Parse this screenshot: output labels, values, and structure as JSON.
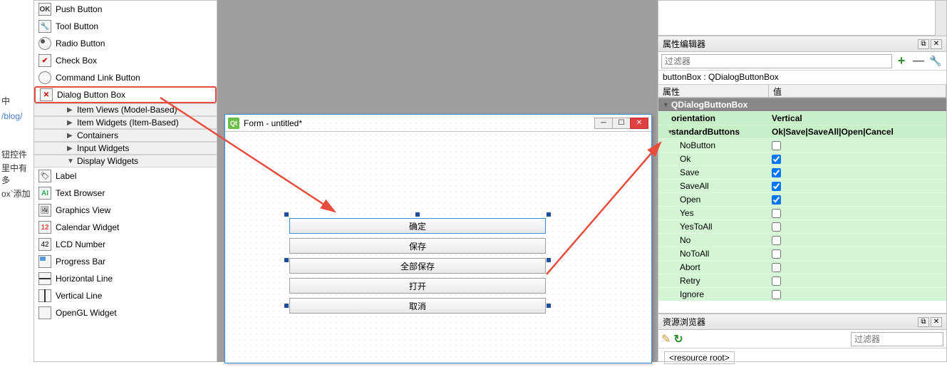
{
  "left": {
    "t1": "中",
    "t2": "/blog/",
    "t3": "钮控件",
    "t4": "里中有多",
    "t5": "ox`添加"
  },
  "widgets": {
    "push": "Push Button",
    "tool": "Tool Button",
    "radio": "Radio Button",
    "check": "Check Box",
    "cmd": "Command Link Button",
    "dlg": "Dialog Button Box",
    "cat_itemviews": "Item Views (Model-Based)",
    "cat_itemwidgets": "Item Widgets (Item-Based)",
    "cat_containers": "Containers",
    "cat_input": "Input Widgets",
    "cat_display": "Display Widgets",
    "label": "Label",
    "tbrowser": "Text Browser",
    "gview": "Graphics View",
    "cal": "Calendar Widget",
    "lcd": "LCD Number",
    "prog": "Progress Bar",
    "hline": "Horizontal Line",
    "vline": "Vertical Line",
    "ogl": "OpenGL Widget",
    "cal_num": "12",
    "lcd_num": "42"
  },
  "form": {
    "title": "Form - untitled*",
    "qt": "Qt",
    "btns": [
      "确定",
      "保存",
      "全部保存",
      "打开",
      "取消"
    ]
  },
  "props": {
    "header": "属性编辑器",
    "filter_ph": "过滤器",
    "obj": "buttonBox : QDialogButtonBox",
    "col1": "属性",
    "col2": "值",
    "class": "QDialogButtonBox",
    "orientation": "orientation",
    "orientation_v": "Vertical",
    "stdbtns": "standardButtons",
    "stdbtns_v": "Ok|Save|SaveAll|Open|Cancel",
    "opts": {
      "NoButton": "NoButton",
      "Ok": "Ok",
      "Save": "Save",
      "SaveAll": "SaveAll",
      "Open": "Open",
      "Yes": "Yes",
      "YesToAll": "YesToAll",
      "No": "No",
      "NoToAll": "NoToAll",
      "Abort": "Abort",
      "Retry": "Retry",
      "Ignore": "Ignore"
    },
    "checked": {
      "Ok": true,
      "Save": true,
      "SaveAll": true,
      "Open": true,
      "Cancel": true
    }
  },
  "res": {
    "header": "资源浏览器",
    "filter_ph": "过滤器",
    "root": "<resource root>"
  }
}
